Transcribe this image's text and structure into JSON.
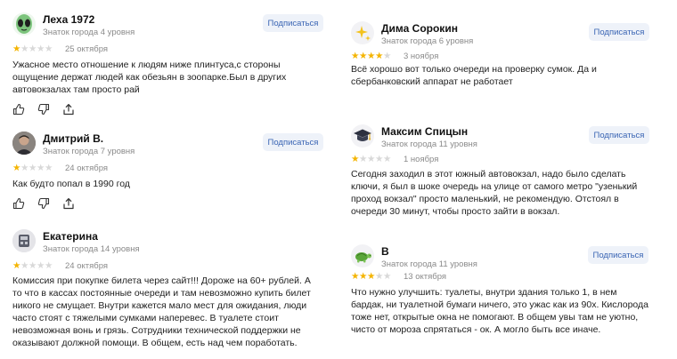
{
  "subscribe_label": "Подписаться",
  "colors": {
    "star_filled": "#f4b400",
    "star_empty": "#d8d8d8",
    "subscribe_bg": "#eef2f9",
    "subscribe_text": "#3a65b4",
    "meta_text": "#8a8a8a"
  },
  "reviews": [
    {
      "author": "Леха 1972",
      "level": "Знаток города 4 уровня",
      "avatar_icon": "alien-icon",
      "rating": 1,
      "date": "25 октября",
      "text": "Ужасное место отношение к людям ниже плинтуса,с стороны ощущение держат людей как обезьян в зоопарке.Был в других автовокзалах там просто рай"
    },
    {
      "author": "Дмитрий В.",
      "level": "Знаток города 7 уровня",
      "avatar_icon": "user-photo",
      "rating": 1,
      "date": "24 октября",
      "text": "Как будто попал в 1990 год"
    },
    {
      "author": "Екатерина",
      "level": "Знаток города 14 уровня",
      "avatar_icon": "user-photo",
      "rating": 1,
      "date": "24 октября",
      "text": "Комиссия при покупке билета через сайт!!! Дороже на 60+ рублей. А то что в кассах постоянные очереди и там невозможно купить билет никого не смущает. Внутри кажется мало мест для ожидания, люди часто стоят с тяжелыми сумками наперевес. В туалете стоит невозможная вонь и грязь. Сотрудники технической поддержки не оказывают должной помощи. В общем, есть над чем поработать."
    },
    {
      "author": "Дима Сорокин",
      "level": "Знаток города 6 уровня",
      "avatar_icon": "sparkles-icon",
      "rating": 4,
      "date": "3 ноября",
      "text": "Всё хорошо вот только очереди на проверку сумок. Да и сбербанковский аппарат не работает"
    },
    {
      "author": "Максим Спицын",
      "level": "Знаток города 11 уровня",
      "avatar_icon": "graduation-cap-icon",
      "rating": 1,
      "date": "1 ноября",
      "text": "Сегодня заходил в этот южный автовокзал, надо было сделать ключи, я был в шоке очередь на улице от самого метро \"узенький проход вокзал\" просто маленький, не рекомендую. Отстоял в очереди 30 минут, чтобы просто зайти в вокзал."
    },
    {
      "author": "В",
      "level": "Знаток города 11 уровня",
      "avatar_icon": "turtle-icon",
      "rating": 3,
      "date": "13 октября",
      "text": "Что нужно улучшить: туалеты, внутри здания только 1, в нем бардак, ни туалетной бумаги ничего, это ужас как из 90х. Кислорода тоже нет, открытые окна не помогают. В общем увы там не уютно, чисто от мороза спрятаться - ок. А могло быть все иначе."
    }
  ]
}
